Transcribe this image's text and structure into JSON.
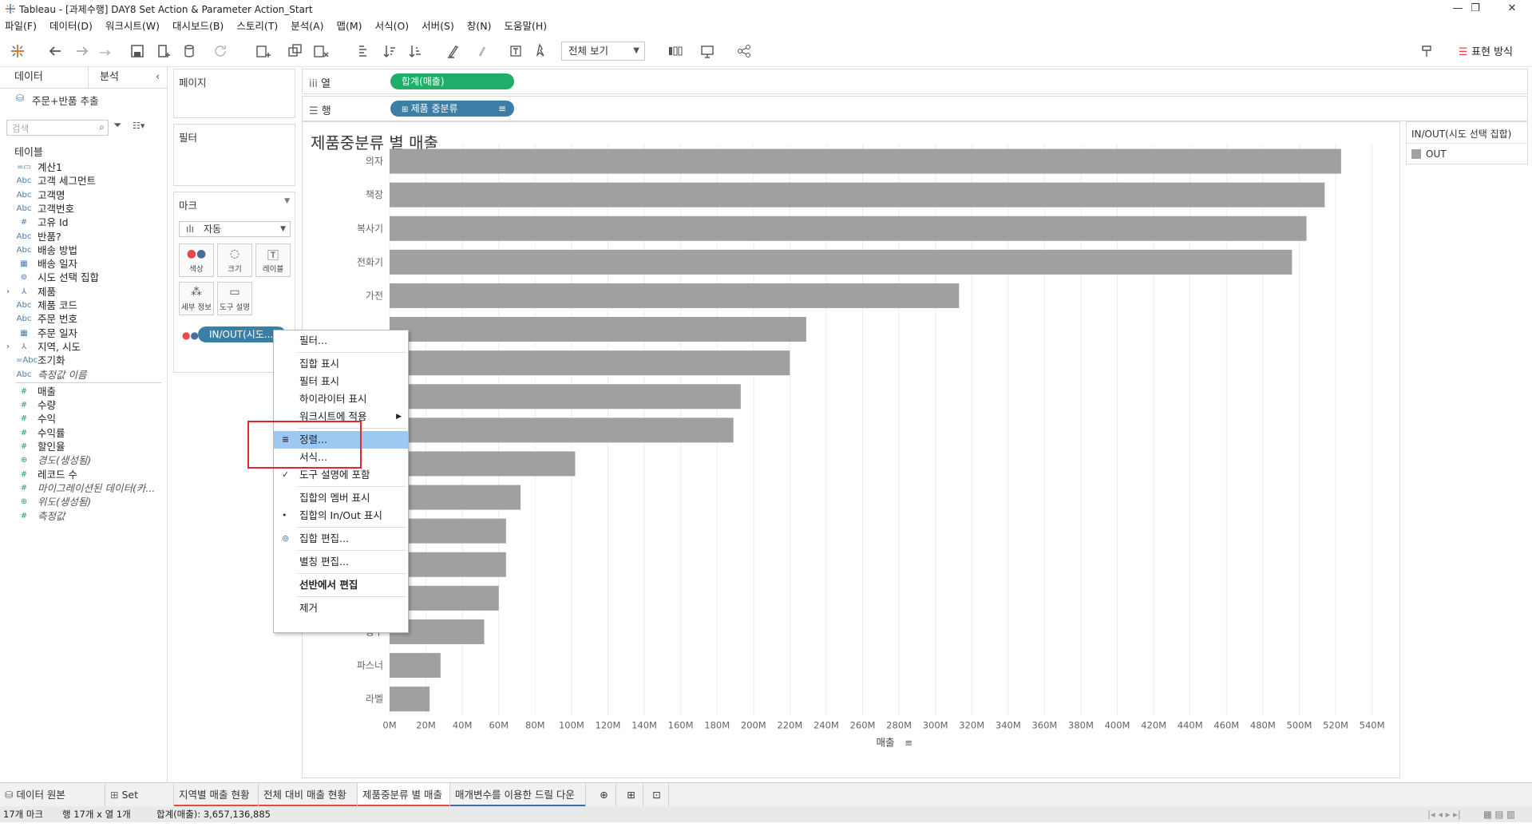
{
  "window": {
    "title": "Tableau - [과제수행] DAY8 Set Action & Parameter Action_Start",
    "controls": [
      "—",
      "❐",
      "✕"
    ]
  },
  "menu": [
    "파일(F)",
    "데이터(D)",
    "워크시트(W)",
    "대시보드(B)",
    "스토리(T)",
    "분석(A)",
    "맵(M)",
    "서식(O)",
    "서버(S)",
    "창(N)",
    "도움말(H)"
  ],
  "toolbar": {
    "view_select": "전체 보기",
    "show_me": "표현 방식"
  },
  "data_pane": {
    "tabs": [
      "데이터",
      "분석"
    ],
    "datasource": "주문+반품 추출",
    "search_placeholder": "검색",
    "section_label": "테이블",
    "fields": [
      {
        "icon": "calc-icon",
        "symbol": "=▭",
        "name": "계산1"
      },
      {
        "icon": "abc-icon",
        "symbol": "Abc",
        "name": "고객 세그먼트"
      },
      {
        "icon": "abc-icon",
        "symbol": "Abc",
        "name": "고객명"
      },
      {
        "icon": "abc-icon",
        "symbol": "Abc",
        "name": "고객번호"
      },
      {
        "icon": "number-icon",
        "symbol": "#",
        "name": "고유 Id"
      },
      {
        "icon": "abc-icon",
        "symbol": "Abc",
        "name": "반품?"
      },
      {
        "icon": "abc-icon",
        "symbol": "Abc",
        "name": "배송 방법"
      },
      {
        "icon": "calendar-icon",
        "symbol": "▦",
        "name": "배송 일자"
      },
      {
        "icon": "set-icon",
        "symbol": "⊚",
        "name": "시도 선택 집합"
      },
      {
        "icon": "hierarchy-icon",
        "symbol": "⅄",
        "name": "제품",
        "expand": "›"
      },
      {
        "icon": "abc-icon",
        "symbol": "Abc",
        "name": "제품 코드"
      },
      {
        "icon": "abc-icon",
        "symbol": "Abc",
        "name": "주문 번호"
      },
      {
        "icon": "calendar-icon",
        "symbol": "▦",
        "name": "주문 일자"
      },
      {
        "icon": "hierarchy-icon",
        "symbol": "⅄",
        "name": "지역, 시도",
        "expand": "›"
      },
      {
        "icon": "abc-icon",
        "symbol": "=Abc",
        "name": "조기화"
      },
      {
        "icon": "abc-icon",
        "symbol": "Abc",
        "name": "측정값 이름",
        "italic": true
      }
    ],
    "measures": [
      {
        "icon": "number-icon",
        "symbol": "#",
        "name": "매출"
      },
      {
        "icon": "number-icon",
        "symbol": "#",
        "name": "수량"
      },
      {
        "icon": "number-icon",
        "symbol": "#",
        "name": "수익"
      },
      {
        "icon": "number-icon",
        "symbol": "#",
        "name": "수익률"
      },
      {
        "icon": "number-icon",
        "symbol": "#",
        "name": "할인율"
      },
      {
        "icon": "globe-icon",
        "symbol": "⊕",
        "name": "경도(생성됨)",
        "italic": true
      },
      {
        "icon": "number-icon",
        "symbol": "#",
        "name": "레코드 수"
      },
      {
        "icon": "number-icon",
        "symbol": "#",
        "name": "마이그레이션된 데이터(카...",
        "italic": true
      },
      {
        "icon": "globe-icon",
        "symbol": "⊕",
        "name": "위도(생성됨)",
        "italic": true
      },
      {
        "icon": "number-icon",
        "symbol": "#",
        "name": "측정값",
        "italic": true
      }
    ]
  },
  "cards": {
    "pages": "페이지",
    "filters": "필터",
    "marks": "마크",
    "mark_type": "자동",
    "mark_buttons": [
      "색상",
      "크기",
      "레이블",
      "세부 정보",
      "도구 설명"
    ],
    "mark_pill": "IN/OUT(시도..."
  },
  "shelves": {
    "columns_label": "열",
    "rows_label": "행",
    "columns_pill": "합계(매출)",
    "rows_pill": "제품 중분류"
  },
  "legend": {
    "title": "IN/OUT(시도 선택 집합)",
    "items": [
      {
        "label": "OUT",
        "color": "#a0a0a0"
      }
    ]
  },
  "context_menu": {
    "items": [
      {
        "label": "필터...",
        "mark": ""
      },
      {
        "sep": true
      },
      {
        "label": "집합 표시",
        "mark": ""
      },
      {
        "label": "필터 표시",
        "mark": ""
      },
      {
        "label": "하이라이터 표시",
        "mark": ""
      },
      {
        "label": "워크시트에 적용",
        "mark": "",
        "submenu": true
      },
      {
        "sep": true
      },
      {
        "label": "정렬...",
        "mark": "sort",
        "active": true
      },
      {
        "label": "서식...",
        "mark": ""
      },
      {
        "label": "도구 설명에 포함",
        "mark": "✓"
      },
      {
        "sep": true
      },
      {
        "label": "집합의 멤버 표시",
        "mark": ""
      },
      {
        "label": "집합의 In/Out 표시",
        "mark": "•"
      },
      {
        "sep": true
      },
      {
        "label": "집합 편집...",
        "mark": "set"
      },
      {
        "sep": true
      },
      {
        "label": "별칭 편집...",
        "mark": ""
      },
      {
        "sep": true
      },
      {
        "label": "선반에서 편집",
        "mark": "",
        "bold": true
      },
      {
        "sep": true
      },
      {
        "label": "제거",
        "mark": ""
      }
    ]
  },
  "sheet_tabs": [
    {
      "label": "데이터 원본",
      "icon": "datasource-icon"
    },
    {
      "label": "Set Action",
      "icon": "dashboard-icon"
    },
    {
      "label": "지역별 매출 현황",
      "underline": "#e8474c"
    },
    {
      "label": "전체 대비 매출 현황",
      "underline": "#e8474c"
    },
    {
      "label": "제품중분류 별 매출",
      "underline": "#e8474c",
      "active": true
    },
    {
      "label": "매개변수를 이용한 드릴 다운",
      "underline": "#3c6ea3"
    }
  ],
  "status": {
    "marks": "17개 마크",
    "rows_cols": "행 17개 x 열 1개",
    "sum": "합계(매출): 3,657,136,885"
  },
  "chart_data": {
    "type": "bar",
    "title": "제품중분류 별 매출",
    "xlabel": "매출",
    "ylabel": "",
    "categories": [
      "의자",
      "책장",
      "복사기",
      "전화기",
      "가전",
      "",
      "",
      "",
      "",
      "",
      "",
      "",
      "",
      "",
      "봉투",
      "파스너",
      "라벨"
    ],
    "values": [
      523,
      514,
      504,
      496,
      313,
      229,
      220,
      193,
      189,
      102,
      72,
      64,
      64,
      60,
      52,
      28,
      22
    ],
    "xlim": [
      0,
      545
    ],
    "xticks": [
      "0M",
      "20M",
      "40M",
      "60M",
      "80M",
      "100M",
      "120M",
      "140M",
      "160M",
      "180M",
      "200M",
      "220M",
      "240M",
      "260M",
      "280M",
      "300M",
      "320M",
      "340M",
      "360M",
      "380M",
      "400M",
      "420M",
      "440M",
      "460M",
      "480M",
      "500M",
      "520M",
      "540M"
    ],
    "bar_color": "#a0a0a0",
    "grid": true,
    "legend": "right"
  }
}
